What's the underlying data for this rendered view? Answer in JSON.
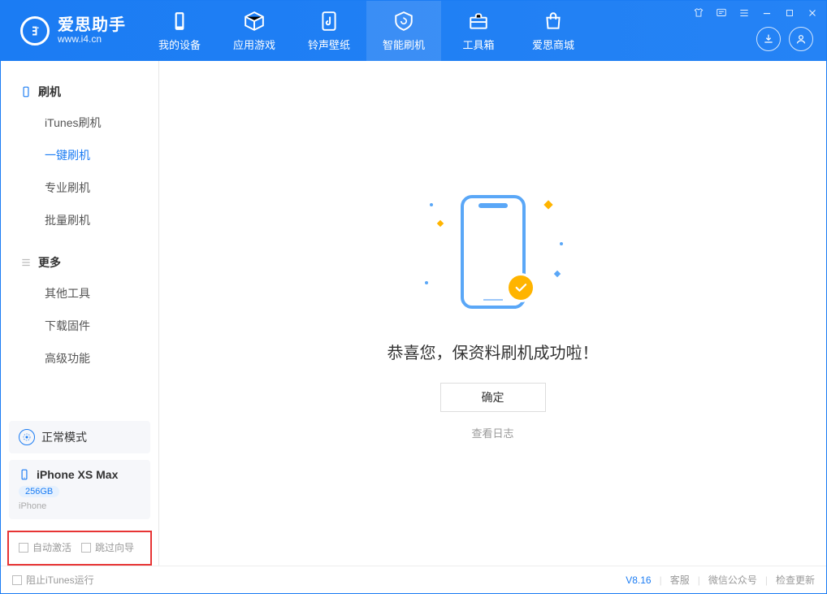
{
  "app": {
    "name_cn": "爱思助手",
    "name_en": "www.i4.cn"
  },
  "tabs": [
    {
      "label": "我的设备"
    },
    {
      "label": "应用游戏"
    },
    {
      "label": "铃声壁纸"
    },
    {
      "label": "智能刷机"
    },
    {
      "label": "工具箱"
    },
    {
      "label": "爱思商城"
    }
  ],
  "sidebar": {
    "section1_title": "刷机",
    "section1_items": [
      "iTunes刷机",
      "一键刷机",
      "专业刷机",
      "批量刷机"
    ],
    "section2_title": "更多",
    "section2_items": [
      "其他工具",
      "下载固件",
      "高级功能"
    ],
    "mode_label": "正常模式",
    "device_name": "iPhone XS Max",
    "device_capacity": "256GB",
    "device_type": "iPhone",
    "check_auto_activate": "自动激活",
    "check_skip_guide": "跳过向导"
  },
  "main": {
    "success_text": "恭喜您，保资料刷机成功啦！",
    "ok_label": "确定",
    "log_label": "查看日志"
  },
  "footer": {
    "block_itunes": "阻止iTunes运行",
    "version": "V8.16",
    "links": [
      "客服",
      "微信公众号",
      "检查更新"
    ]
  }
}
